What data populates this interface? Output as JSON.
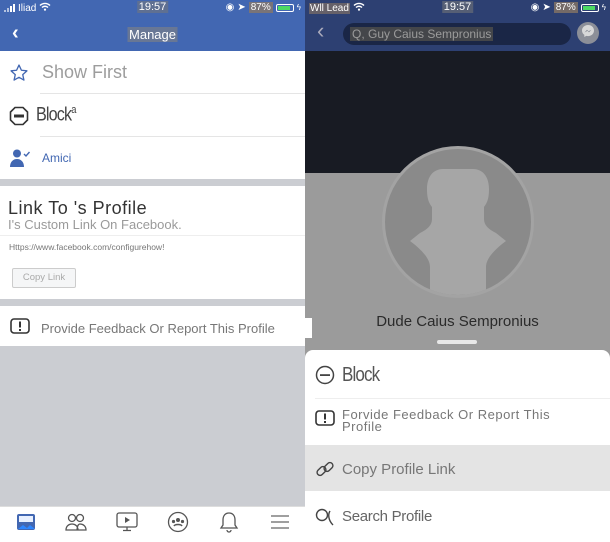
{
  "left": {
    "status": {
      "carrier": "Iliad",
      "time": "19:57",
      "battery": "87%"
    },
    "nav": {
      "back": "‹",
      "title": "Manage"
    },
    "menu": [
      {
        "icon": "star-icon",
        "label": "Show First"
      },
      {
        "icon": "block-icon",
        "label": "Block",
        "suffix": "a"
      },
      {
        "icon": "friends-icon",
        "label": "Amici"
      }
    ],
    "link_card": {
      "title": "Link To 's Profile",
      "subtitle": "I's Custom Link On Facebook.",
      "url": "Https://www.facebook.com/configurehow!",
      "copy_button": "Copy Link"
    },
    "feedback": {
      "label": "Provide Feedback Or Report This Profile"
    },
    "tabbar": [
      "news-feed-icon",
      "friends-icon",
      "watch-icon",
      "groups-icon",
      "notifications-icon",
      "menu-icon"
    ]
  },
  "right": {
    "status": {
      "carrier": "Wll Lead",
      "time": "19:57",
      "battery": "87%"
    },
    "search": {
      "value": "Q, Guy Caius Sempronius"
    },
    "profile_name": "Dude Caius Sempronius",
    "sheet": [
      {
        "icon": "block-icon",
        "label": "Block"
      },
      {
        "icon": "report-icon",
        "label": "Forvide Feedback Or Report This Profile"
      },
      {
        "icon": "link-icon",
        "label": "Copy Profile Link"
      },
      {
        "icon": "search-icon",
        "label": "Search Profile"
      }
    ]
  },
  "colors": {
    "fb_blue": "#4267b2",
    "dark_nav": "#2d4072",
    "cover": "#181b23"
  }
}
